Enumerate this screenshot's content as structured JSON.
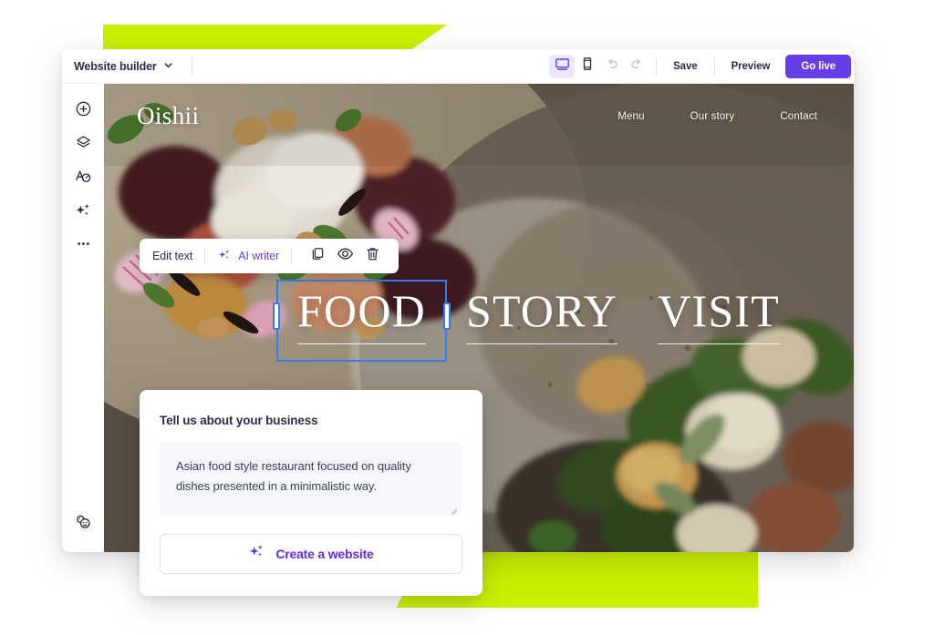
{
  "app": {
    "brand_label": "Website builder",
    "brand_chevron_icon": "chevron-down-icon"
  },
  "toolbar": {
    "desktop_icon": "desktop-monitor-icon",
    "mobile_icon": "mobile-phone-icon",
    "undo_icon": "undo-arrow-icon",
    "redo_icon": "redo-arrow-icon",
    "save_label": "Save",
    "preview_label": "Preview",
    "go_live_label": "Go live",
    "active_device": "desktop",
    "accent_color": "#673de6"
  },
  "sidebar": {
    "items": [
      {
        "name": "add-element",
        "icon": "plus-circle-icon"
      },
      {
        "name": "layers",
        "icon": "layers-icon"
      },
      {
        "name": "text-style",
        "icon": "font-text-icon"
      },
      {
        "name": "ai-tools",
        "icon": "sparkles-icon"
      },
      {
        "name": "more-options",
        "icon": "ellipsis-icon"
      }
    ],
    "bottom_item": {
      "name": "support-chat",
      "icon": "smiley-chat-icon"
    }
  },
  "element_toolbar": {
    "edit_text_label": "Edit text",
    "ai_writer_label": "AI writer",
    "ai_writer_icon": "sparkles-icon",
    "duplicate_icon": "duplicate-copy-icon",
    "hide_icon": "eye-visibility-icon",
    "delete_icon": "trash-bin-icon",
    "ai_color": "#673de6"
  },
  "site_preview": {
    "logo": "Oishii",
    "nav_links": [
      "Menu",
      "Our story",
      "Contact"
    ],
    "headline_words": [
      {
        "text": "FOOD",
        "selected": true
      },
      {
        "text": "STORY",
        "selected": false
      },
      {
        "text": "VISIT",
        "selected": false
      }
    ],
    "selection_color": "#2f7df4",
    "background_description": "food-photography-hero-image"
  },
  "business_panel": {
    "title": "Tell us about your business",
    "description_value": "Asian food style restaurant focused on quality dishes presented in a minimalistic way.",
    "description_placeholder": "Tell us about your business",
    "create_button_label": "Create a website",
    "create_button_icon": "sparkles-icon",
    "create_button_color": "#5b2ee5"
  },
  "decor": {
    "lime_color": "#c9f000"
  }
}
